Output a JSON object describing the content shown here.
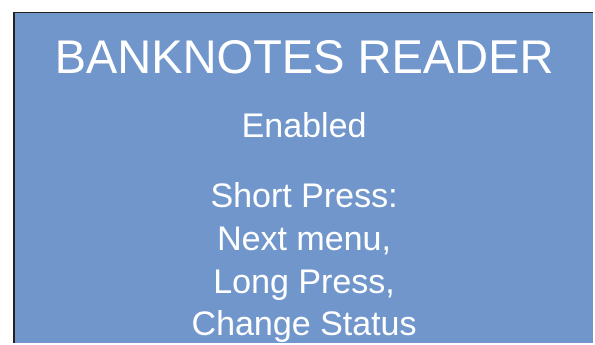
{
  "screen": {
    "title": "BANKNOTES READER",
    "status": "Enabled",
    "instructions": [
      "Short Press:",
      "Next menu,",
      "Long Press,",
      "Change Status"
    ]
  },
  "colors": {
    "screen_background": "#7096cc",
    "text": "#ffffff"
  }
}
